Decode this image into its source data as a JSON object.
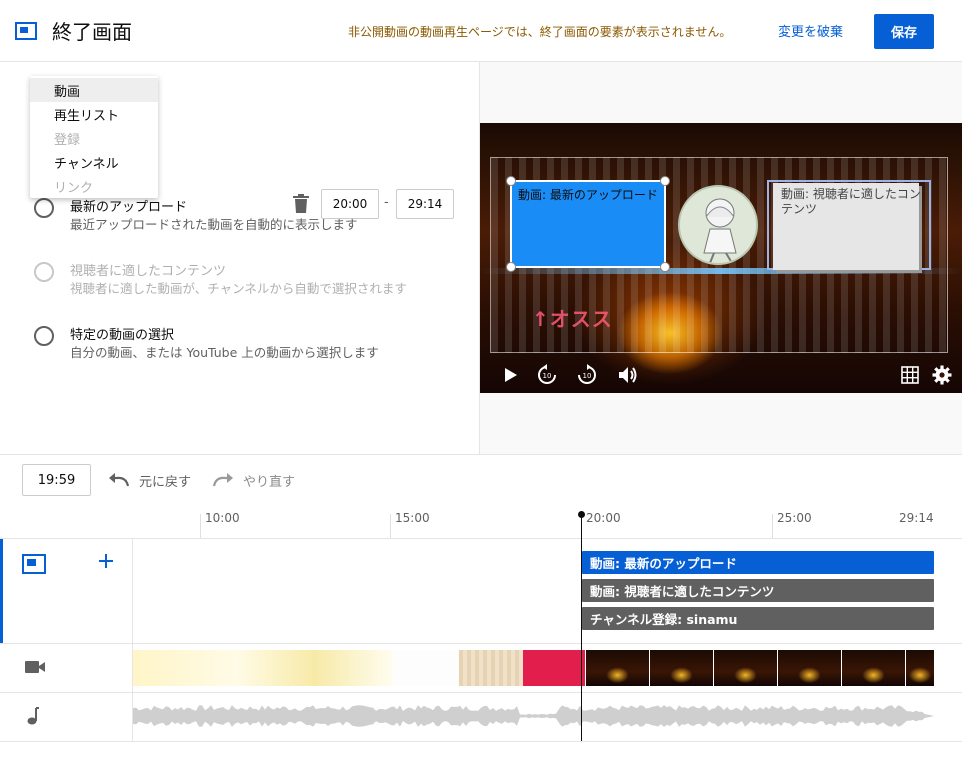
{
  "header": {
    "title": "終了画面",
    "warning": "非公開動画の動画再生ページでは、終了画面の要素が表示されません。",
    "discard_label": "変更を破棄",
    "save_label": "保存"
  },
  "dropdown": {
    "items": [
      {
        "label": "動画",
        "selected": true,
        "disabled": false
      },
      {
        "label": "再生リスト",
        "selected": false,
        "disabled": false
      },
      {
        "label": "登録",
        "selected": false,
        "disabled": true
      },
      {
        "label": "チャンネル",
        "selected": false,
        "disabled": false
      },
      {
        "label": "リンク",
        "selected": false,
        "disabled": true
      }
    ]
  },
  "element_time": {
    "start": "20:00",
    "separator": "-",
    "end": "29:14"
  },
  "options": [
    {
      "title": "最新のアップロード",
      "description": "最近アップロードされた動画を自動的に表示します",
      "disabled": false
    },
    {
      "title": "視聴者に適したコンテンツ",
      "description": "視聴者に適した動画が、チャンネルから自動で選択されます",
      "disabled": true
    },
    {
      "title": "特定の動画の選択",
      "description": "自分の動画、または YouTube 上の動画から選択します",
      "disabled": false
    }
  ],
  "preview": {
    "overlay_text": "↑オスス",
    "element_latest_label": "動画: 最新のアップロード",
    "element_suggested_label": "動画: 視聴者に適したコンテンツ"
  },
  "toolbar": {
    "current_time": "19:59",
    "undo_label": "元に戻す",
    "redo_label": "やり直す"
  },
  "ruler": {
    "labels": [
      "10:00",
      "15:00",
      "20:00",
      "25:00",
      "29:14"
    ]
  },
  "timeline": {
    "bars": [
      {
        "label": "動画: 最新のアップロード",
        "color": "#065fd4"
      },
      {
        "label": "動画: 視聴者に適したコンテンツ",
        "color": "#606060"
      },
      {
        "label": "チャンネル登録: sinamu",
        "color": "#606060"
      }
    ]
  },
  "colors": {
    "accent": "#065fd4",
    "warning_text": "#8a5a00",
    "end_element_blue": "#1a8cf5"
  },
  "icons": {
    "header": "end-screen-icon",
    "delete": "trash-icon",
    "undo": "undo-icon",
    "redo": "redo-icon",
    "add": "plus-icon",
    "video_track": "video-camera-icon",
    "audio_track": "music-note-icon"
  }
}
